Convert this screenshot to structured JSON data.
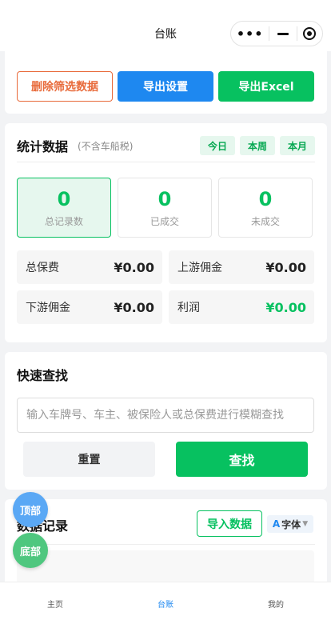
{
  "header": {
    "title": "台账"
  },
  "capsule": {
    "more_icon": "more-dots-icon",
    "minimize_icon": "minus-icon",
    "close_icon": "target-icon"
  },
  "actions": {
    "delete_filtered": "删除筛选数据",
    "export_settings": "导出设置",
    "export_excel": "导出Excel"
  },
  "stats": {
    "title": "统计数据",
    "note": "(不含车船税)",
    "periods": [
      "今日",
      "本周",
      "本月"
    ],
    "boxes": [
      {
        "value": "0",
        "label": "总记录数"
      },
      {
        "value": "0",
        "label": "已成交"
      },
      {
        "value": "0",
        "label": "未成交"
      }
    ],
    "money": [
      {
        "label": "总保费",
        "value": "¥0.00"
      },
      {
        "label": "上游佣金",
        "value": "¥0.00"
      },
      {
        "label": "下游佣金",
        "value": "¥0.00"
      },
      {
        "label": "利润",
        "value": "¥0.00"
      }
    ]
  },
  "quick_search": {
    "title": "快速查找",
    "placeholder": "输入车牌号、车主、被保险人或总保费进行模糊查找",
    "reset_label": "重置",
    "search_label": "查找"
  },
  "records": {
    "title": "数据记录",
    "import_label": "导入数据",
    "font_a": "A",
    "font_label": "字体",
    "font_arrow": "▼"
  },
  "float": {
    "top_label": "顶部",
    "bottom_label": "底部"
  },
  "tabbar": {
    "items": [
      {
        "label": "主页"
      },
      {
        "label": "台账"
      },
      {
        "label": "我的"
      }
    ],
    "active": "台账"
  },
  "colors": {
    "accent_green": "#07c160",
    "accent_blue": "#1e88f0",
    "danger_orange": "#e86a3a"
  }
}
